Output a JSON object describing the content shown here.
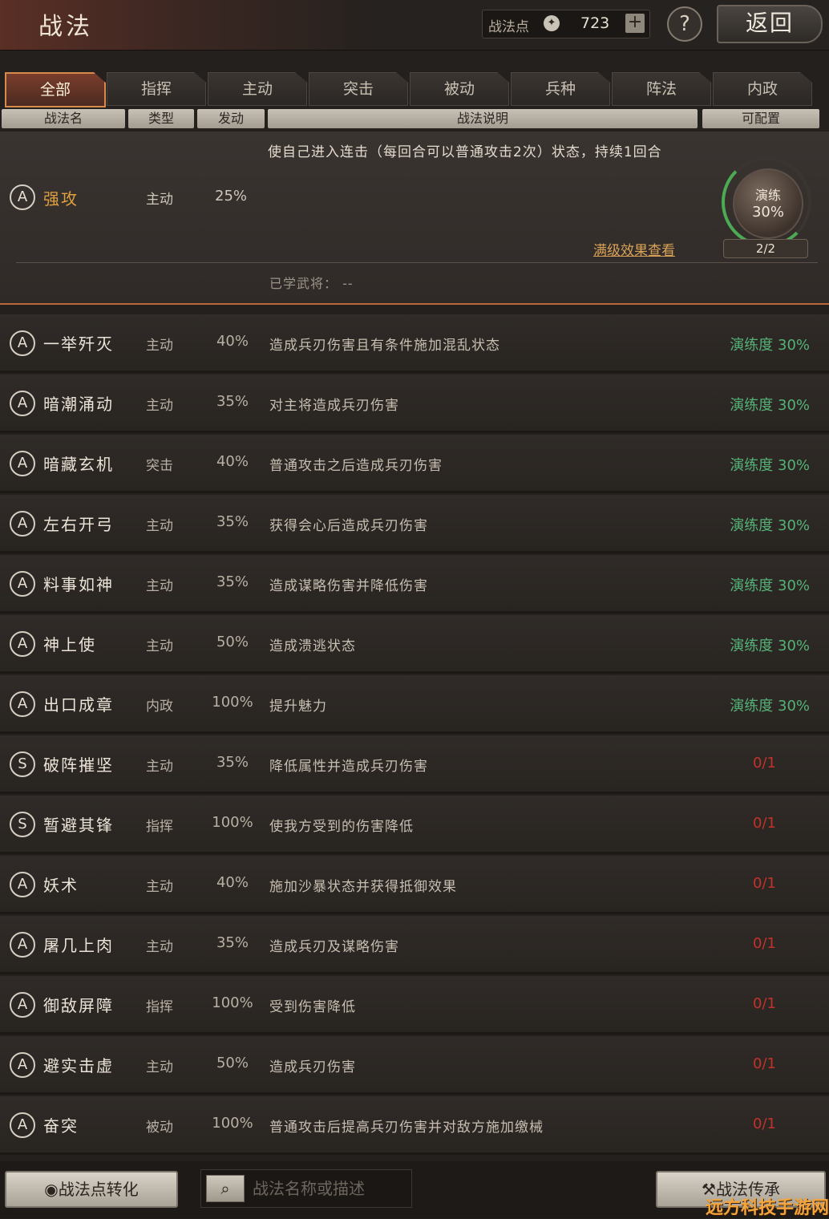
{
  "header": {
    "title": "战法",
    "points_label": "战法点",
    "coin_icon": "compass-icon",
    "points_value": "723",
    "plus_label": "+",
    "help_label": "?",
    "back_label": "返回"
  },
  "tabs": [
    "全部",
    "指挥",
    "主动",
    "突击",
    "被动",
    "兵种",
    "阵法",
    "内政"
  ],
  "active_tab": "全部",
  "columns": {
    "name": "战法名",
    "type": "类型",
    "rate": "发动",
    "desc": "战法说明",
    "config": "可配置"
  },
  "expanded": {
    "grade": "A",
    "name": "强攻",
    "type": "主动",
    "rate": "25%",
    "desc": "使自己进入连击（每回合可以普通攻击2次）状态，持续1回合",
    "max_link": "满级效果查看",
    "drill_label": "演练",
    "drill_pct": "30%",
    "drill_count": "2/2",
    "learned": "已学武将：  --"
  },
  "rows": [
    {
      "grade": "A",
      "name": "一举歼灭",
      "type": "主动",
      "rate": "40%",
      "desc": "造成兵刃伤害且有条件施加混乱状态",
      "status": "演练度 30%"
    },
    {
      "grade": "A",
      "name": "暗潮涌动",
      "type": "主动",
      "rate": "35%",
      "desc": "对主将造成兵刃伤害",
      "status": "演练度 30%"
    },
    {
      "grade": "A",
      "name": "暗藏玄机",
      "type": "突击",
      "rate": "40%",
      "desc": "普通攻击之后造成兵刃伤害",
      "status": "演练度 30%"
    },
    {
      "grade": "A",
      "name": "左右开弓",
      "type": "主动",
      "rate": "35%",
      "desc": "获得会心后造成兵刃伤害",
      "status": "演练度 30%"
    },
    {
      "grade": "A",
      "name": "料事如神",
      "type": "主动",
      "rate": "35%",
      "desc": "造成谋略伤害并降低伤害",
      "status": "演练度 30%"
    },
    {
      "grade": "A",
      "name": "神上使",
      "type": "主动",
      "rate": "50%",
      "desc": "造成溃逃状态",
      "status": "演练度 30%"
    },
    {
      "grade": "A",
      "name": "出口成章",
      "type": "内政",
      "rate": "100%",
      "desc": "提升魅力",
      "status": "演练度 30%"
    },
    {
      "grade": "S",
      "name": "破阵摧坚",
      "type": "主动",
      "rate": "35%",
      "desc": "降低属性并造成兵刃伤害",
      "status": "0/1"
    },
    {
      "grade": "S",
      "name": "暂避其锋",
      "type": "指挥",
      "rate": "100%",
      "desc": "使我方受到的伤害降低",
      "status": "0/1"
    },
    {
      "grade": "A",
      "name": "妖术",
      "type": "主动",
      "rate": "40%",
      "desc": "施加沙暴状态并获得抵御效果",
      "status": "0/1"
    },
    {
      "grade": "A",
      "name": "屠几上肉",
      "type": "主动",
      "rate": "35%",
      "desc": "造成兵刃及谋略伤害",
      "status": "0/1"
    },
    {
      "grade": "A",
      "name": "御敌屏障",
      "type": "指挥",
      "rate": "100%",
      "desc": "受到伤害降低",
      "status": "0/1"
    },
    {
      "grade": "A",
      "name": "避实击虚",
      "type": "主动",
      "rate": "50%",
      "desc": "造成兵刃伤害",
      "status": "0/1"
    },
    {
      "grade": "A",
      "name": "奋突",
      "type": "被动",
      "rate": "100%",
      "desc": "普通攻击后提高兵刃伤害并对敌方施加缴械",
      "status": "0/1"
    }
  ],
  "bottom": {
    "convert_label": "战法点转化",
    "convert_icon": "compass-icon",
    "search_icon": "search-icon",
    "search_placeholder": "战法名称或描述",
    "inherit_label": "战法传承",
    "inherit_icon": "hammer-icon"
  },
  "watermark": "远方科技手游网",
  "colors": {
    "accent": "#d88a4c",
    "drill_green": "#55b277",
    "lack_red": "#c2322a",
    "highlight_name": "#e0a040"
  }
}
